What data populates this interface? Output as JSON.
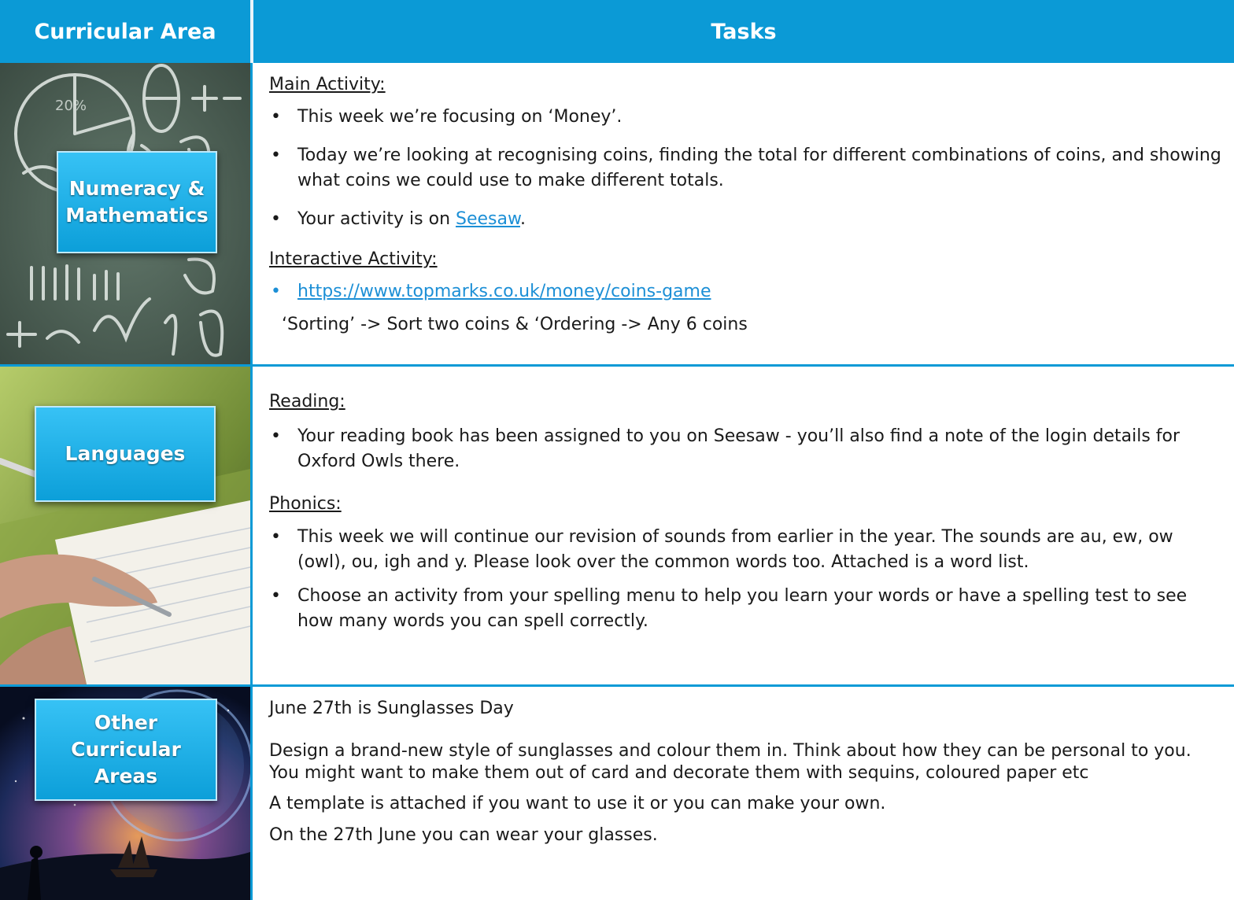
{
  "header": {
    "col1": "Curricular Area",
    "col2": "Tasks"
  },
  "rows": {
    "numeracy": {
      "label": "Numeracy & Mathematics",
      "main_heading": "Main Activity:",
      "bullet1": "This week we’re focusing on ‘Money’.",
      "bullet2": "Today we’re looking at recognising coins, finding the total for different combinations of coins, and showing what coins we could use to make different totals.",
      "bullet3_pre": "Your activity is on ",
      "bullet3_link": "Seesaw",
      "bullet3_post": ".",
      "interactive_heading": "Interactive Activity:",
      "interactive_link": "https://www.topmarks.co.uk/money/coins-game",
      "interactive_note": "‘Sorting’ -> Sort two coins & ‘Ordering -> Any 6 coins"
    },
    "languages": {
      "label": "Languages",
      "reading_heading": "Reading:",
      "reading_bullet": "Your reading book has been assigned to you on Seesaw - you’ll also find a note of the login details for Oxford Owls there.",
      "phonics_heading": "Phonics:",
      "phonics_bullet1": "This week we will continue our revision of sounds from earlier in the year. The sounds are au, ew, ow (owl), ou, igh and y. Please look over the common words too. Attached is a word list.",
      "phonics_bullet2": "Choose an activity from your spelling menu to help you learn your words or have a spelling test to see how many words you can spell correctly."
    },
    "other": {
      "label": "Other Curricular Areas",
      "line1": "June 27th is Sunglasses Day",
      "line2": "Design a brand-new style of sunglasses and colour them in. Think about how they can be personal to you. You might want to make them out of card and decorate them with sequins, coloured paper etc",
      "line3": "A template is attached if you want to use it or you can make your own.",
      "line4": "On the 27th June you can wear your glasses."
    }
  }
}
